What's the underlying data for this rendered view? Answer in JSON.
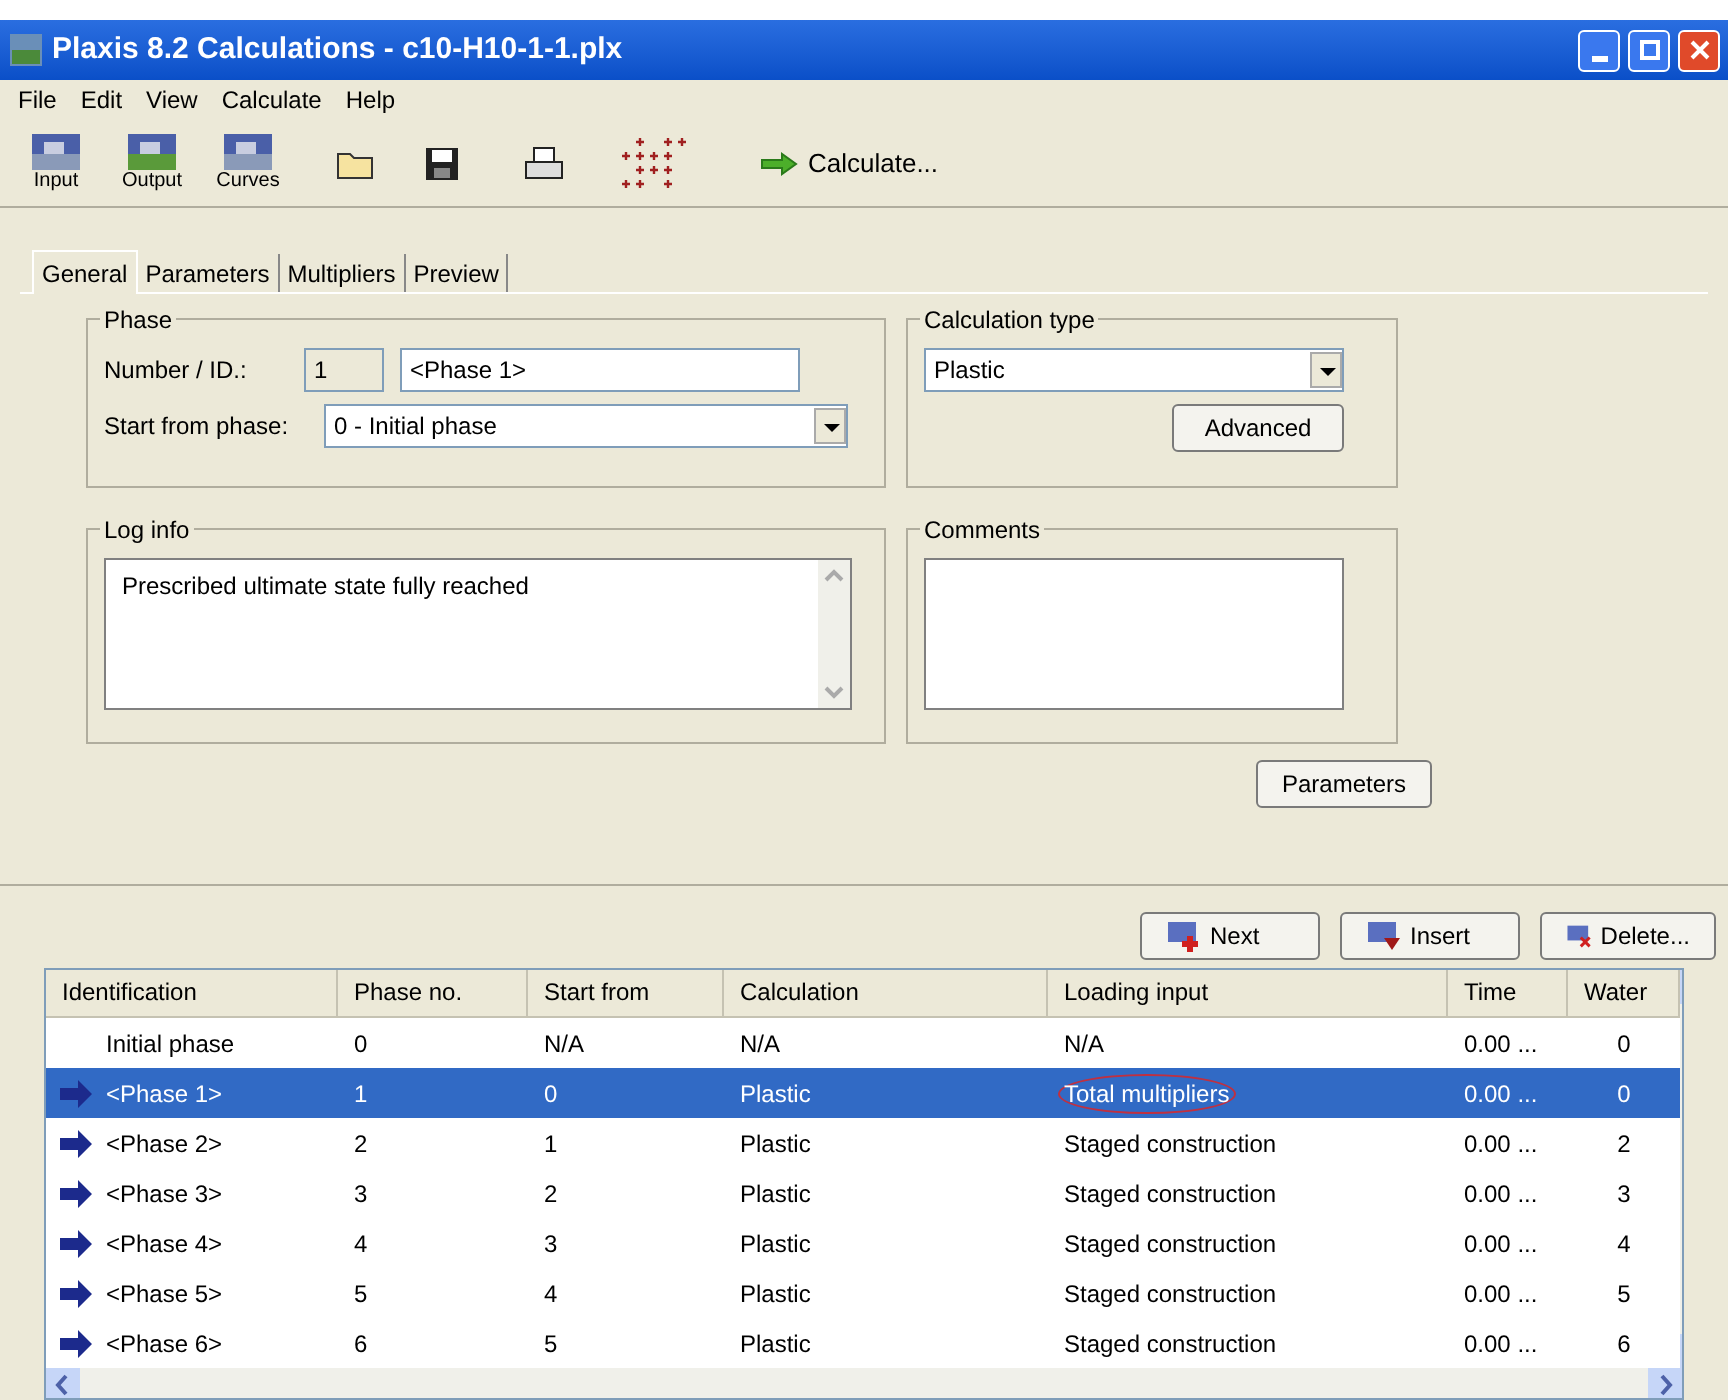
{
  "window": {
    "title": "Plaxis 8.2 Calculations - c10-H10-1-1.plx"
  },
  "menu": [
    "File",
    "Edit",
    "View",
    "Calculate",
    "Help"
  ],
  "toolbar": [
    {
      "label": "Input",
      "kind": "app"
    },
    {
      "label": "Output",
      "kind": "app"
    },
    {
      "label": "Curves",
      "kind": "app"
    },
    {
      "kind": "open"
    },
    {
      "kind": "save"
    },
    {
      "kind": "print"
    },
    {
      "kind": "points"
    },
    {
      "kind": "calculate",
      "label": "Calculate..."
    }
  ],
  "tabs": [
    {
      "label": "General",
      "selected": true
    },
    {
      "label": "Parameters",
      "selected": false
    },
    {
      "label": "Multipliers",
      "selected": false
    },
    {
      "label": "Preview",
      "selected": false
    }
  ],
  "phase": {
    "title": "Phase",
    "number_label": "Number / ID.:",
    "number": "1",
    "id": "<Phase 1>",
    "start_label": "Start from phase:",
    "start": "0 - Initial phase"
  },
  "calculation_type": {
    "title": "Calculation type",
    "value": "Plastic",
    "button": "Advanced"
  },
  "log_info": {
    "title": "Log info",
    "text": "Prescribed ultimate state fully reached"
  },
  "comments": {
    "title": "Comments"
  },
  "parameters_button": "Parameters",
  "actions": [
    {
      "label": "Next",
      "kind": "next"
    },
    {
      "label": "Insert",
      "kind": "insert"
    },
    {
      "label": "Delete...",
      "kind": "delete"
    }
  ],
  "table": {
    "columns": [
      "Identification",
      "Phase no.",
      "Start from",
      "Calculation",
      "Loading input",
      "Time",
      "Water"
    ],
    "rows": [
      {
        "arrow": false,
        "selected": false,
        "circled": false,
        "cells": [
          "Initial phase",
          "0",
          "N/A",
          "N/A",
          "N/A",
          "0.00 ...",
          "0"
        ]
      },
      {
        "arrow": true,
        "selected": true,
        "circled": true,
        "cells": [
          "<Phase 1>",
          "1",
          "0",
          "Plastic",
          "Total multipliers",
          "0.00 ...",
          "0"
        ]
      },
      {
        "arrow": true,
        "selected": false,
        "circled": false,
        "cells": [
          "<Phase 2>",
          "2",
          "1",
          "Plastic",
          "Staged construction",
          "0.00 ...",
          "2"
        ]
      },
      {
        "arrow": true,
        "selected": false,
        "circled": false,
        "cells": [
          "<Phase 3>",
          "3",
          "2",
          "Plastic",
          "Staged construction",
          "0.00 ...",
          "3"
        ]
      },
      {
        "arrow": true,
        "selected": false,
        "circled": false,
        "cells": [
          "<Phase 4>",
          "4",
          "3",
          "Plastic",
          "Staged construction",
          "0.00 ...",
          "4"
        ]
      },
      {
        "arrow": true,
        "selected": false,
        "circled": false,
        "cells": [
          "<Phase 5>",
          "5",
          "4",
          "Plastic",
          "Staged construction",
          "0.00 ...",
          "5"
        ]
      },
      {
        "arrow": true,
        "selected": false,
        "circled": false,
        "cells": [
          "<Phase 6>",
          "6",
          "5",
          "Plastic",
          "Staged construction",
          "0.00 ...",
          "6"
        ]
      }
    ]
  }
}
